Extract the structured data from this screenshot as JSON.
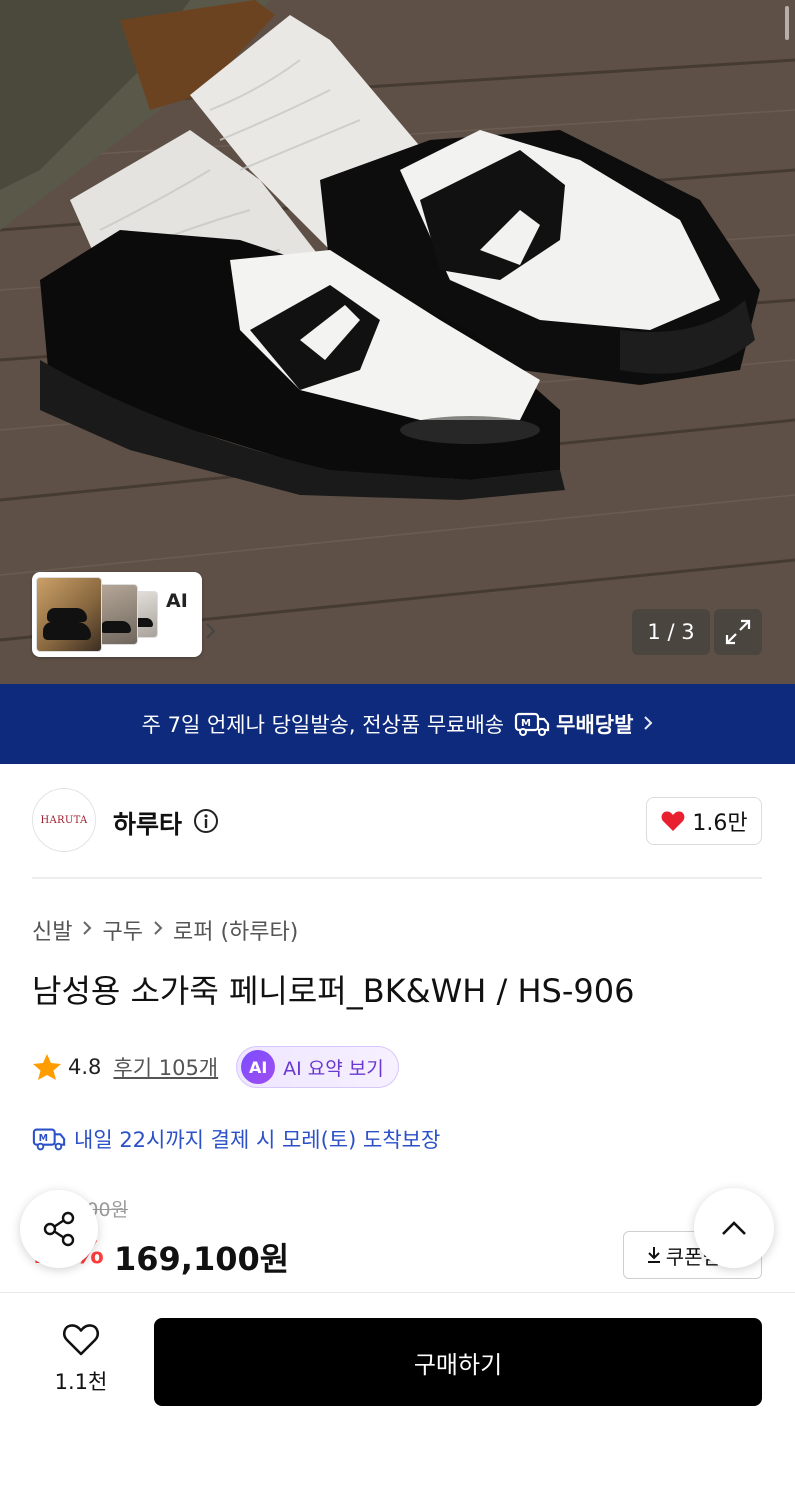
{
  "hero": {
    "thumb_label": "AI",
    "counter": "1 / 3"
  },
  "banner": {
    "text": "주 7일 언제나 당일발송, 전상품 무료배송",
    "badge": "무배당발",
    "badge_icon_text": "M"
  },
  "brand": {
    "logo_text": "HARUTA",
    "name": "하루타",
    "like_count": "1.6만"
  },
  "breadcrumb": [
    "신발",
    "구두",
    "로퍼 (하루타)"
  ],
  "product": {
    "title": "남성용 소가죽 페니로퍼_BK&WH / HS-906",
    "rating": "4.8",
    "reviews": "후기 105개",
    "ai_badge": "AI",
    "ai_summary": "AI 요약 보기",
    "delivery": "내일 22시까지 결제 시 모레(토) 도착보장",
    "original_price": "199,000원",
    "discount": "15%",
    "price": "169,100원",
    "coupon": "쿠폰받기"
  },
  "bottom": {
    "wish_count": "1.1천",
    "buy_label": "구매하기"
  },
  "colors": {
    "banner_bg": "#0d2a7d",
    "heart": "#e8202f",
    "discount": "#ff3b3b",
    "delivery_text": "#2b50c8",
    "ai_purple": "#6a38d0",
    "star": "#ff9d00",
    "buy_bg": "#000000"
  },
  "icons": [
    "info-icon",
    "heart-icon",
    "star-icon",
    "chevron-right-icon",
    "expand-icon",
    "share-icon",
    "chevron-up-icon",
    "download-icon",
    "heart-outline-icon",
    "delivery-truck-icon"
  ]
}
